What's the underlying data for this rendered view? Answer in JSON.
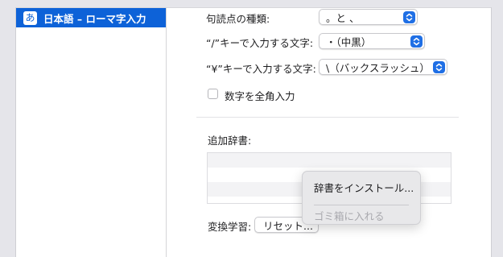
{
  "sidebar": {
    "items": [
      {
        "icon_glyph": "あ",
        "icon": "hiragana-input-icon",
        "label": "日本語 – ローマ字入力",
        "selected": true
      }
    ]
  },
  "settings": {
    "punctuation": {
      "label": "句読点の種類:",
      "value": "。と 、"
    },
    "slash_key": {
      "label": "“/”キーで入力する文字:",
      "value": "・（中黒）"
    },
    "yen_key": {
      "label": "“¥”キーで入力する文字:",
      "value": "\\（バックスラッシュ）"
    },
    "fullwidth_numbers": {
      "label": "数字を全角入力",
      "checked": false
    },
    "dictionary": {
      "label": "追加辞書:"
    },
    "learning": {
      "label": "変換学習:",
      "button_label": "リセット..."
    }
  },
  "context_menu": {
    "items": [
      {
        "label": "辞書をインストール...",
        "enabled": true
      },
      {
        "label": "ゴミ箱に入れる",
        "enabled": false
      }
    ]
  },
  "colors": {
    "accent": "#0d62d8",
    "stepper": "#1f6fe5",
    "background": "#e5e5ea"
  }
}
